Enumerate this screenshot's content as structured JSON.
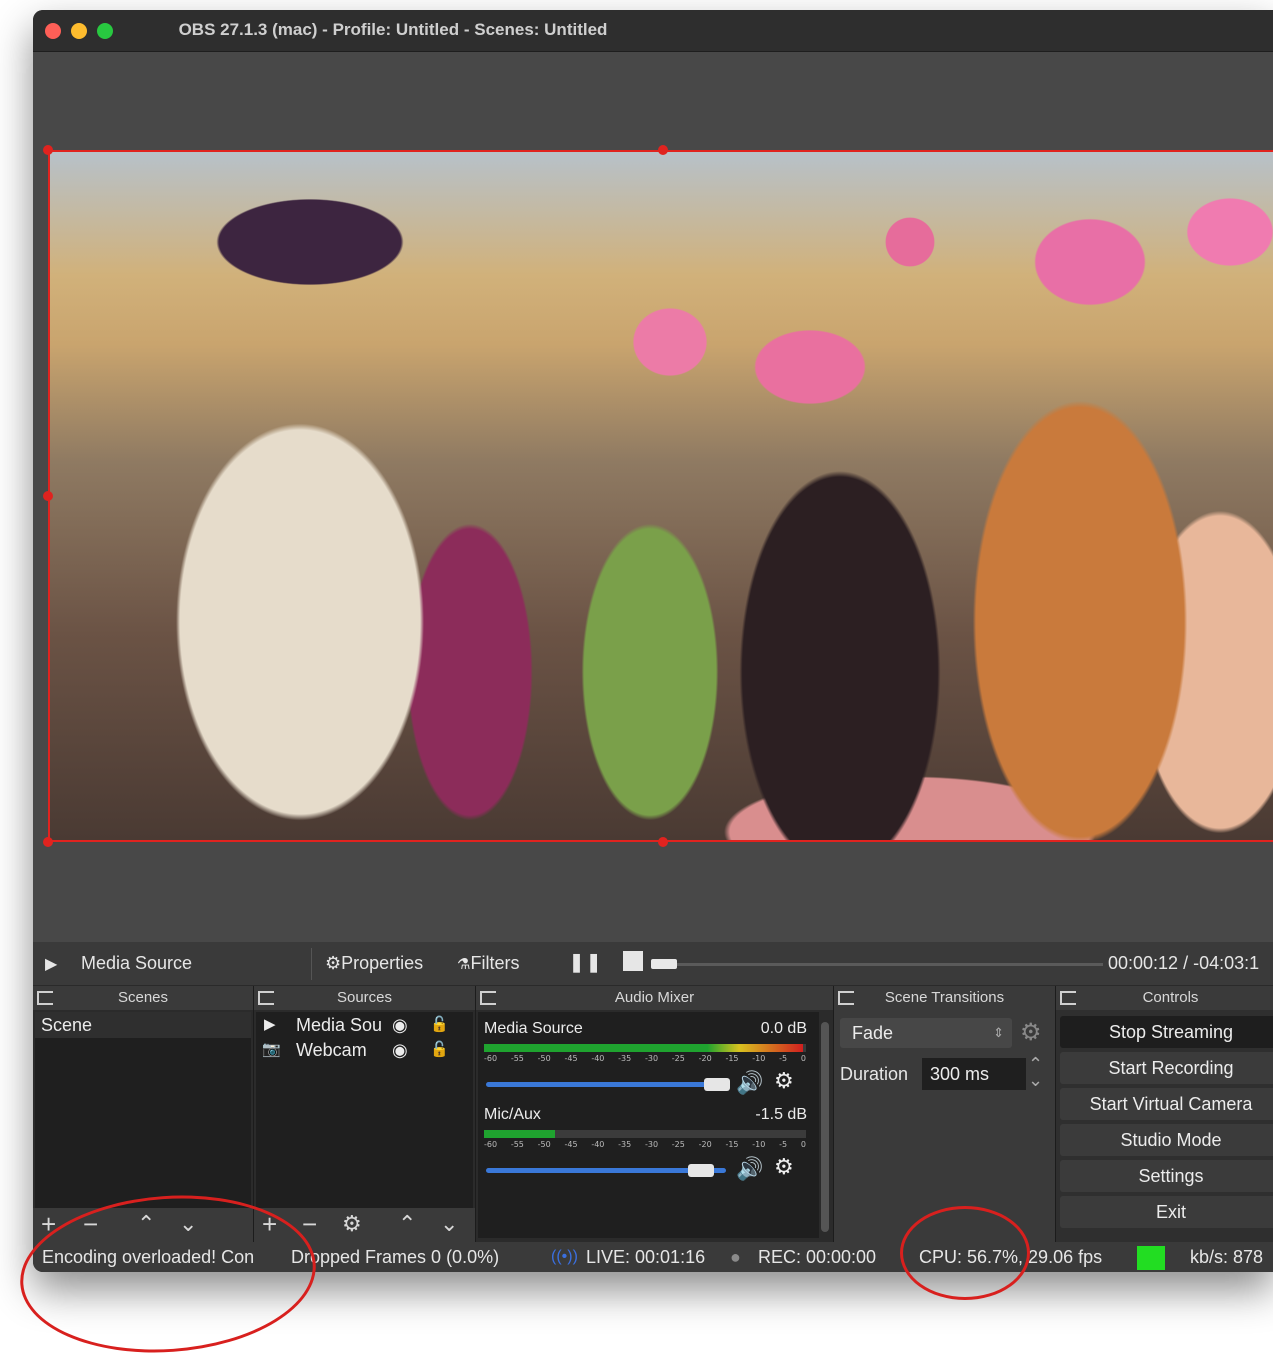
{
  "window": {
    "title": "OBS 27.1.3 (mac) - Profile: Untitled - Scenes: Untitled",
    "traffic_lights": {
      "close": "#fe5f57",
      "minimize": "#febc2e",
      "zoom": "#28c840"
    }
  },
  "preview": {
    "selection_color": "#e0231f"
  },
  "transport": {
    "play_icon": "play-icon",
    "source_name": "Media Source",
    "properties_label": "Properties",
    "filters_label": "Filters",
    "time": "00:00:12 / -04:03:1",
    "seek_progress": 0.02
  },
  "docks": {
    "scenes": {
      "title": "Scenes",
      "items": [
        "Scene"
      ]
    },
    "sources": {
      "title": "Sources",
      "items": [
        {
          "name": "Media Sou",
          "icon": "play-icon"
        },
        {
          "name": "Webcam",
          "icon": "camera-icon"
        }
      ]
    },
    "audio_mixer": {
      "title": "Audio Mixer",
      "channels": [
        {
          "name": "Media Source",
          "level": "0.0 dB",
          "meter_fill": 0.99,
          "volume": 0.96
        },
        {
          "name": "Mic/Aux",
          "level": "-1.5 dB",
          "meter_fill": 0.22,
          "volume": 0.9
        }
      ],
      "scale": [
        "-60",
        "-55",
        "-50",
        "-45",
        "-40",
        "-35",
        "-30",
        "-25",
        "-20",
        "-15",
        "-10",
        "-5",
        "0"
      ]
    },
    "scene_transitions": {
      "title": "Scene Transitions",
      "transition": "Fade",
      "duration_label": "Duration",
      "duration_value": "300 ms"
    },
    "controls": {
      "title": "Controls",
      "buttons": [
        "Stop Streaming",
        "Start Recording",
        "Start Virtual Camera",
        "Studio Mode",
        "Settings",
        "Exit"
      ]
    }
  },
  "status": {
    "encoding": "Encoding overloaded! Con",
    "dropped": "Dropped Frames 0 (0.0%)",
    "live": "LIVE: 00:01:16",
    "rec": "REC: 00:00:00",
    "cpu": "CPU: 56.7%, 29.06 fps",
    "health_color": "#22dd22",
    "kbps": "kb/s: 878"
  }
}
